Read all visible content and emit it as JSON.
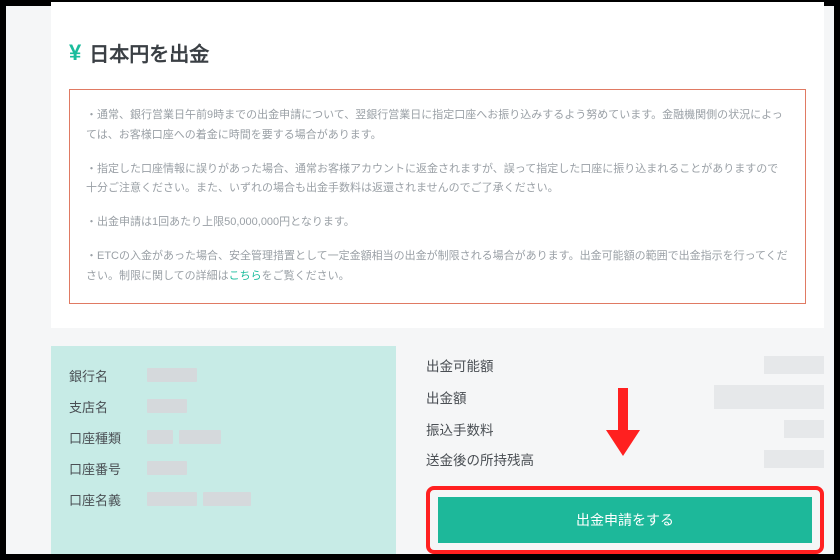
{
  "header": {
    "icon": "¥",
    "title": "日本円を出金"
  },
  "notices": {
    "n1": "・通常、銀行営業日午前9時までの出金申請について、翌銀行営業日に指定口座へお振り込みするよう努めています。金融機関側の状況によっては、お客様口座への着金に時間を要する場合があります。",
    "n2": "・指定した口座情報に誤りがあった場合、通常お客様アカウントに返金されますが、誤って指定した口座に振り込まれることがありますので十分ご注意ください。また、いずれの場合も出金手数料は返還されませんのでご了承ください。",
    "n3": "・出金申請は1回あたり上限50,000,000円となります。",
    "n4_a": "・ETCの入金があった場合、安全管理措置として一定金額相当の出金が制限される場合があります。出金可能額の範囲で出金指示を行ってください。制限に関しての詳細は",
    "n4_link": "こちら",
    "n4_b": "をご覧ください。"
  },
  "bank": {
    "labels": {
      "name": "銀行名",
      "branch": "支店名",
      "type": "口座種類",
      "number": "口座番号",
      "holder": "口座名義"
    }
  },
  "amounts": {
    "labels": {
      "available": "出金可能額",
      "amount": "出金額",
      "fee": "振込手数料",
      "balance": "送金後の所持残高"
    }
  },
  "submit": {
    "label": "出金申請をする"
  }
}
